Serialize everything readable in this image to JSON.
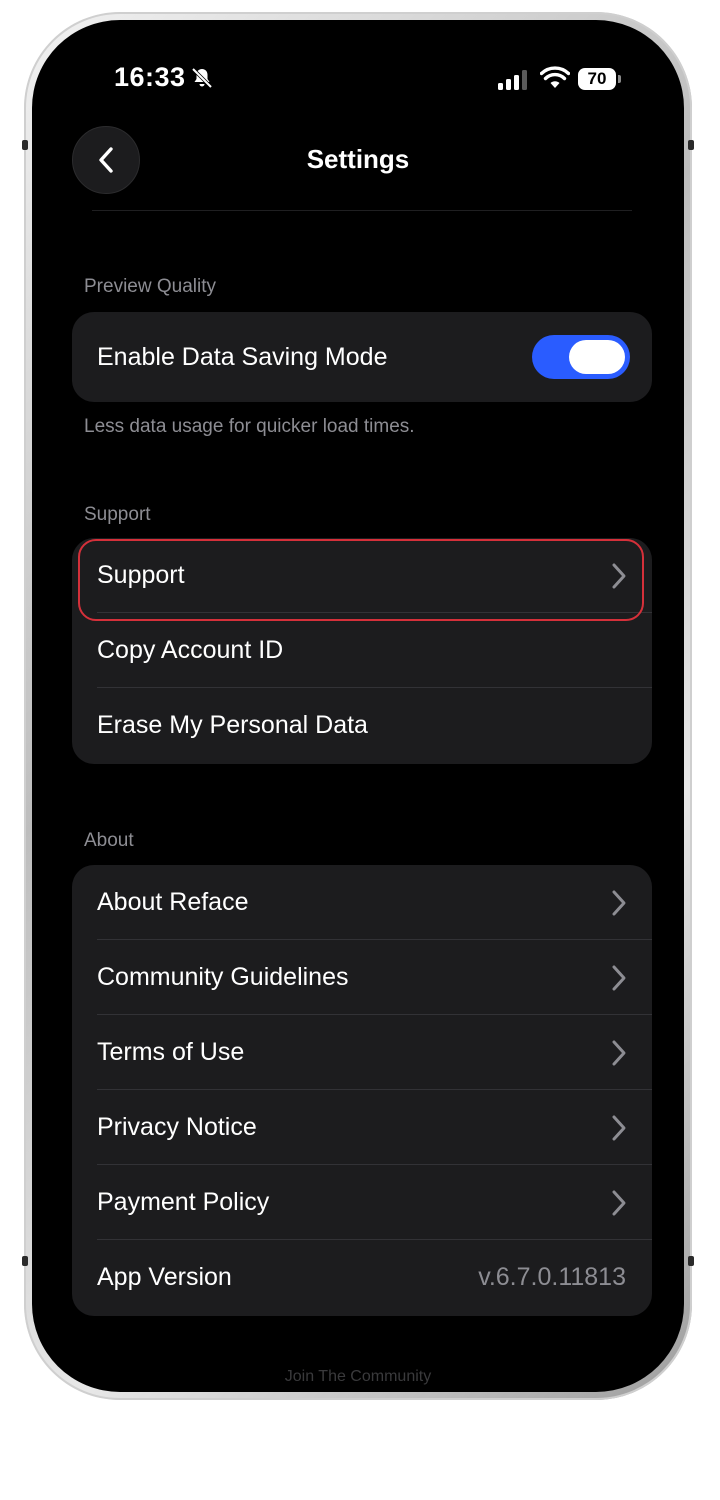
{
  "status_bar": {
    "time": "16:33",
    "battery": "70"
  },
  "nav": {
    "title": "Settings"
  },
  "preview_quality": {
    "header": "Preview Quality",
    "toggle_label": "Enable Data Saving Mode",
    "toggle_on": true,
    "footer": "Less data usage for quicker load times."
  },
  "support": {
    "header": "Support",
    "items": [
      {
        "label": "Support",
        "chevron": true
      },
      {
        "label": "Copy Account ID",
        "chevron": false
      },
      {
        "label": "Erase My Personal Data",
        "chevron": false
      }
    ]
  },
  "about": {
    "header": "About",
    "items": [
      {
        "label": "About Reface"
      },
      {
        "label": "Community Guidelines"
      },
      {
        "label": "Terms of Use"
      },
      {
        "label": "Privacy Notice"
      },
      {
        "label": "Payment Policy"
      }
    ],
    "version_label": "App Version",
    "version_value": "v.6.7.0.11813"
  },
  "footer_partial": "Join The Community",
  "colors": {
    "accent": "#2a5cff",
    "highlight": "#d5303a",
    "card_bg": "#1c1c1e",
    "secondary_text": "#8d8d93"
  }
}
